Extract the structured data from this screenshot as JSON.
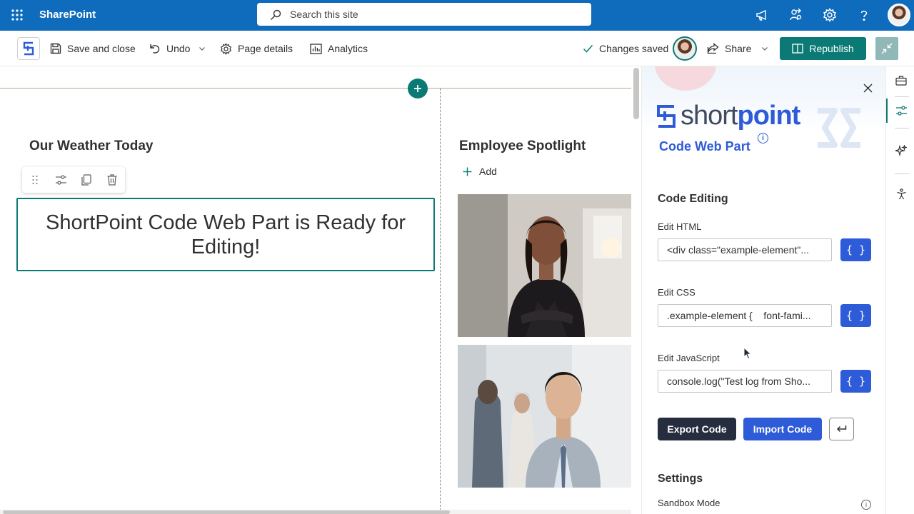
{
  "suite_bar": {
    "app_name": "SharePoint",
    "search_placeholder": "Search this site",
    "icons": [
      "waffle-icon",
      "megaphone-icon",
      "share-network-icon",
      "gear-icon",
      "help-icon"
    ],
    "brand_color": "#0f6cbd"
  },
  "command_bar": {
    "save_close": "Save and close",
    "undo": "Undo",
    "page_details": "Page details",
    "analytics": "Analytics",
    "changes_saved": "Changes saved",
    "share": "Share",
    "republish": "Republish",
    "accent_color": "#0b7a75"
  },
  "canvas": {
    "left_section_title": "Our Weather Today",
    "right_section_title": "Employee Spotlight",
    "add_label": "Add",
    "webpart_message": "ShortPoint Code Web Part is Ready for Editing!"
  },
  "pane": {
    "logo_text_light": "short",
    "logo_text_bold": "point",
    "title": "Code Web Part",
    "info_glyph": "i",
    "code_editing_heading": "Code Editing",
    "fields": [
      {
        "label": "Edit HTML",
        "value": "<div class=\"example-element\"...",
        "button": "{ }"
      },
      {
        "label": "Edit CSS",
        "value": ".example-element {    font-fami...",
        "button": "{ }"
      },
      {
        "label": "Edit JavaScript",
        "value": "console.log(\"Test log from Sho...",
        "button": "{ }"
      }
    ],
    "export_label": "Export Code",
    "import_label": "Import Code",
    "settings_heading": "Settings",
    "sandbox_label": "Sandbox Mode",
    "sandbox_info_glyph": "i",
    "primary_color": "#2e5bd8"
  }
}
